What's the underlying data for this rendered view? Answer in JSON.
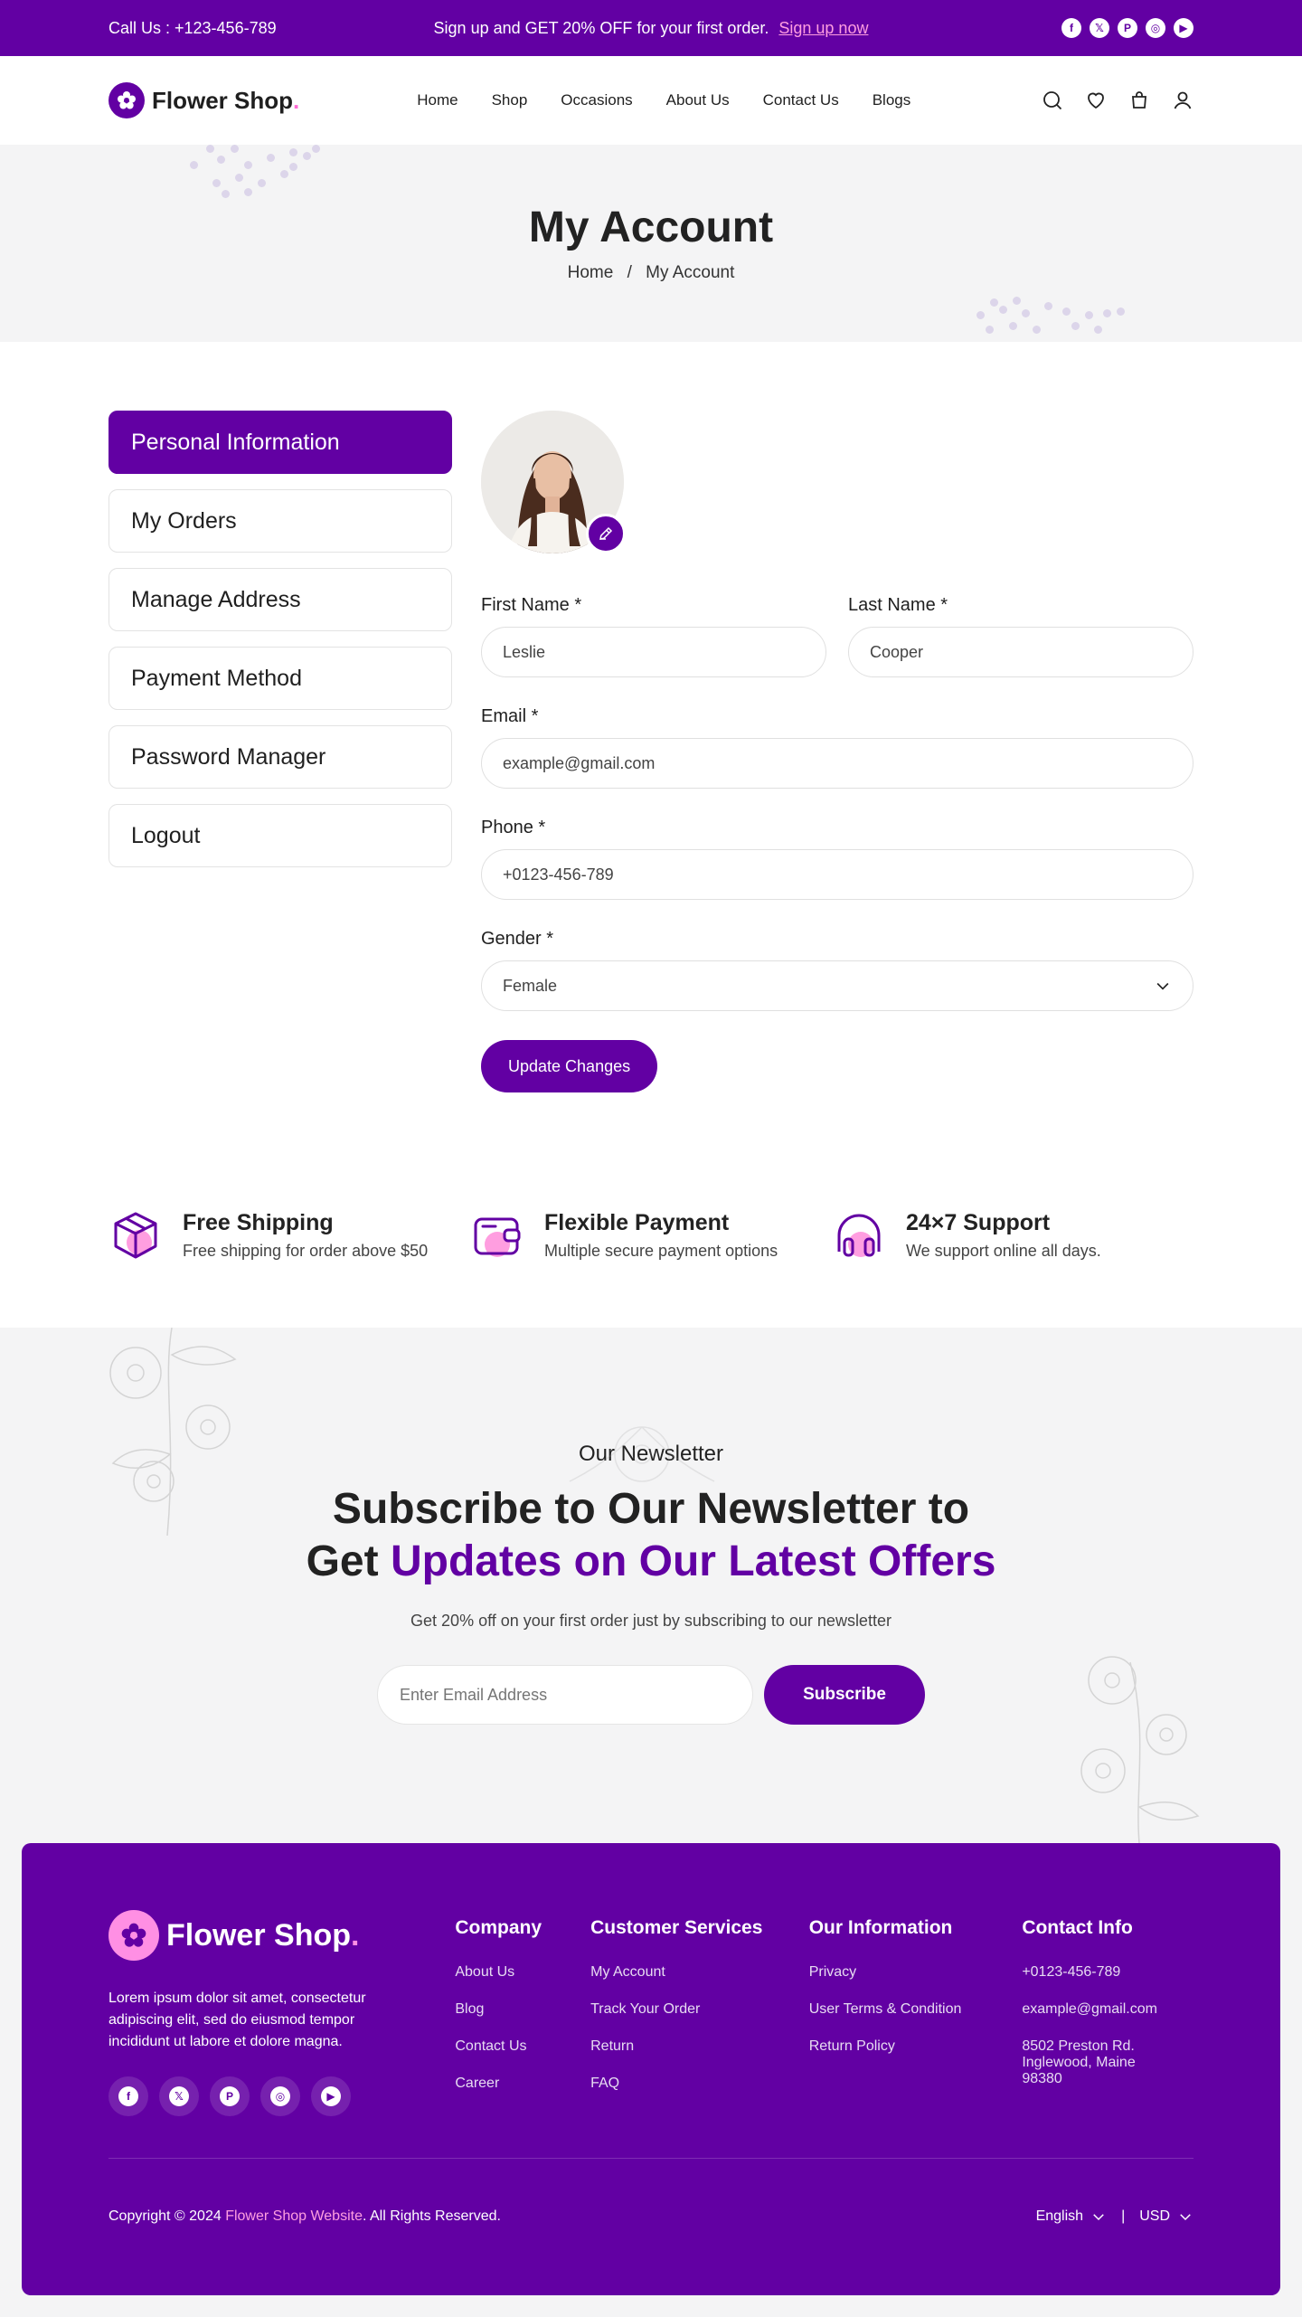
{
  "topbar": {
    "call": "Call Us : +123-456-789",
    "promo_text": "Sign up and GET 20% OFF for your first order.",
    "promo_link": "Sign up now",
    "socials": [
      "facebook-icon",
      "x-icon",
      "pinterest-icon",
      "instagram-icon",
      "youtube-icon"
    ]
  },
  "header": {
    "brand": "Flower Shop",
    "brand_dot": ".",
    "nav": [
      "Home",
      "Shop",
      "Occasions",
      "About Us",
      "Contact Us",
      "Blogs"
    ],
    "icons": [
      "search-icon",
      "heart-icon",
      "bag-icon",
      "user-icon"
    ]
  },
  "banner": {
    "title": "My Account",
    "breadcrumb_home": "Home",
    "breadcrumb_sep": "/",
    "breadcrumb_current": "My Account"
  },
  "sidebar": {
    "items": [
      {
        "label": "Personal Information",
        "active": true
      },
      {
        "label": "My Orders",
        "active": false
      },
      {
        "label": "Manage Address",
        "active": false
      },
      {
        "label": "Payment Method",
        "active": false
      },
      {
        "label": "Password Manager",
        "active": false
      },
      {
        "label": "Logout",
        "active": false
      }
    ]
  },
  "form": {
    "first_name_label": "First Name *",
    "first_name_value": "Leslie",
    "last_name_label": "Last Name *",
    "last_name_value": "Cooper",
    "email_label": "Email *",
    "email_value": "example@gmail.com",
    "phone_label": "Phone *",
    "phone_value": "+0123-456-789",
    "gender_label": "Gender *",
    "gender_value": "Female",
    "submit_label": "Update Changes"
  },
  "features": [
    {
      "icon": "box-icon",
      "title": "Free Shipping",
      "text": "Free shipping for order above $50"
    },
    {
      "icon": "wallet-icon",
      "title": "Flexible Payment",
      "text": "Multiple secure payment options"
    },
    {
      "icon": "headphones-icon",
      "title": "24×7 Support",
      "text": "We support online all days."
    }
  ],
  "newsletter": {
    "eyebrow": "Our Newsletter",
    "heading_line1": "Subscribe to Our Newsletter to",
    "heading_line2_plain": "Get ",
    "heading_line2_highlight": "Updates on Our Latest Offers",
    "subtitle": "Get 20% off on your first order just by subscribing to our newsletter",
    "input_placeholder": "Enter Email Address",
    "button_label": "Subscribe"
  },
  "footer": {
    "brand": "Flower Shop",
    "brand_dot": ".",
    "about": "Lorem ipsum dolor sit amet, consectetur adipiscing elit, sed do eiusmod tempor incididunt ut labore et dolore magna.",
    "columns": [
      {
        "title": "Company",
        "links": [
          "About Us",
          "Blog",
          "Contact Us",
          "Career"
        ]
      },
      {
        "title": "Customer Services",
        "links": [
          "My Account",
          "Track Your Order",
          "Return",
          "FAQ"
        ]
      },
      {
        "title": "Our Information",
        "links": [
          "Privacy",
          "User Terms & Condition",
          "Return Policy"
        ]
      },
      {
        "title": "Contact Info",
        "links": [
          "+0123-456-789",
          "example@gmail.com",
          "8502 Preston Rd. Inglewood, Maine 98380"
        ]
      }
    ],
    "copyright_prefix": "Copyright © 2024 ",
    "copyright_brand": "Flower Shop Website",
    "copyright_suffix": ". All Rights Reserved.",
    "language": "English",
    "separator": "|",
    "currency": "USD"
  },
  "colors": {
    "primary": "#6200a3",
    "accent_pink": "#ff8fe4",
    "background_gray": "#f4f4f5"
  }
}
